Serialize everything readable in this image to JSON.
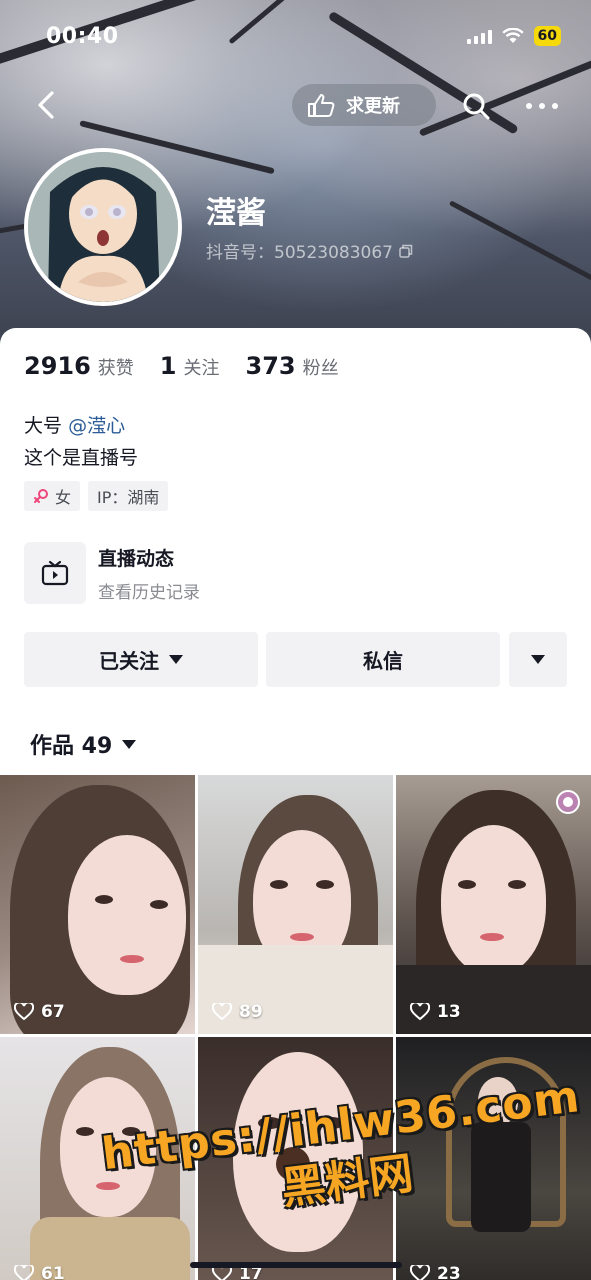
{
  "status_bar": {
    "time": "00:40",
    "battery": "60"
  },
  "nav": {
    "update_label": "求更新"
  },
  "profile": {
    "nickname": "滢酱",
    "douyin_id": "抖音号：50523083067",
    "stats": [
      {
        "value": "2916",
        "label": "获赞"
      },
      {
        "value": "1",
        "label": "关注"
      },
      {
        "value": "373",
        "label": "粉丝"
      }
    ],
    "bio_prefix": "大号",
    "bio_mention": "@滢心",
    "bio_line2": "这个是直播号",
    "tags": [
      {
        "icon": "female-icon",
        "text": "女"
      },
      {
        "icon": "",
        "text": "IP：湖南"
      }
    ]
  },
  "live": {
    "title": "直播动态",
    "subtitle": "查看历史记录"
  },
  "actions": {
    "follow_label": "已关注",
    "message_label": "私信"
  },
  "works_tab": {
    "label": "作品 49"
  },
  "videos": [
    {
      "likes": "67"
    },
    {
      "likes": "89"
    },
    {
      "likes": "13"
    },
    {
      "likes": "61"
    },
    {
      "likes": "17"
    },
    {
      "likes": "23"
    }
  ],
  "watermark": {
    "url": "https://ihlw36.com",
    "name": "黑料网"
  },
  "colors": {
    "accent_mention": "#2b5c96",
    "battery": "#f5d90a",
    "watermark": "#f6a623"
  }
}
